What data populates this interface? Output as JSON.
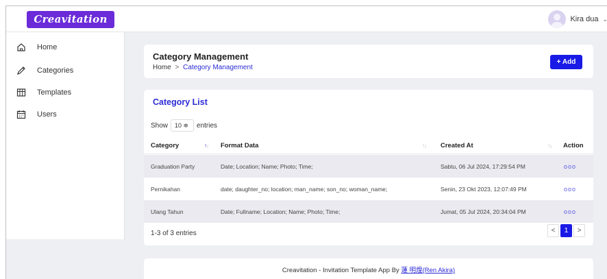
{
  "app": {
    "logo_text": "Creavitation"
  },
  "user": {
    "name": "Kira dua",
    "chevron": "⌄"
  },
  "sidebar": {
    "items": [
      {
        "label": "Home",
        "icon": "home-icon"
      },
      {
        "label": "Categories",
        "icon": "pen-icon"
      },
      {
        "label": "Templates",
        "icon": "grid-icon"
      },
      {
        "label": "Users",
        "icon": "calendar-icon"
      }
    ]
  },
  "header": {
    "title": "Category Management",
    "breadcrumb": {
      "home": "Home",
      "separator": ">",
      "current": "Category Management"
    },
    "add_label": "+ Add"
  },
  "list": {
    "title": "Category List",
    "show_label": "Show",
    "entries_value": "10 ≑",
    "entries_label": "entries",
    "columns": [
      "Category",
      "Format Data",
      "Created At",
      "Action"
    ],
    "rows": [
      {
        "category": "Graduation Party",
        "format": "Date; Location; Name; Photo; Time;",
        "created": "Sabtu, 06 Jul 2024, 17:29:54 PM",
        "action": "ooo"
      },
      {
        "category": "Pernikahan",
        "format": "date; daughter_no; location; man_name; son_no; woman_name;",
        "created": "Senin, 23 Okt 2023, 12:07:49 PM",
        "action": "ooo"
      },
      {
        "category": "Ulang Tahun",
        "format": "Date; Fullname; Location; Name; Photo; Time;",
        "created": "Jumat, 05 Jul 2024, 20:34:04 PM",
        "action": "ooo"
      }
    ],
    "info": "1-3 of 3 entries",
    "pagination": {
      "prev": "<",
      "page": "1",
      "next": ">"
    }
  },
  "footer": {
    "text": "Creavitation - Invitation Template App By ",
    "link": "蓮 明煌(Ren Akira)"
  },
  "colors": {
    "accent": "#1a1ae6",
    "brand": "#6b2bd9",
    "link": "#2b2bd6"
  }
}
